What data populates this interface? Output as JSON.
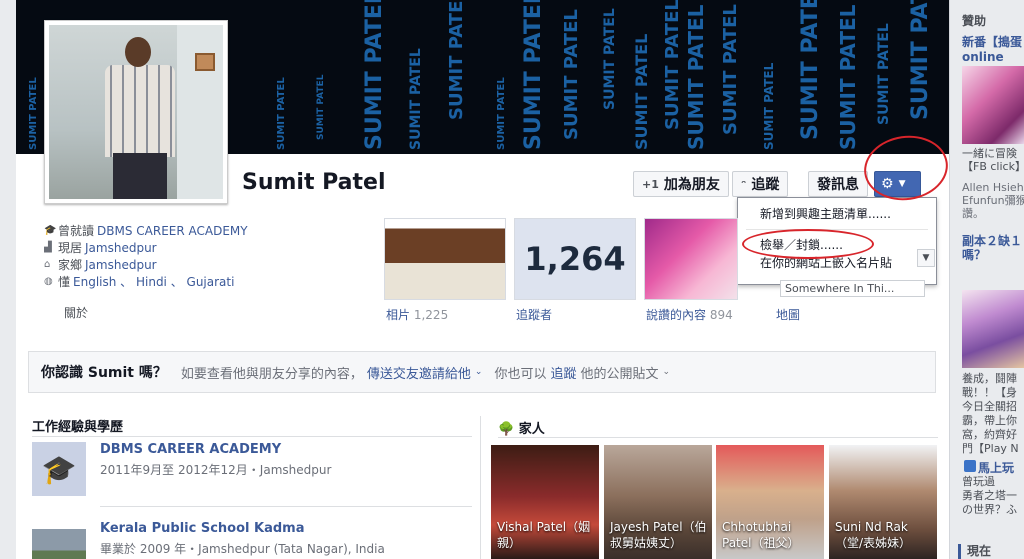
{
  "profile": {
    "name": "Sumit Patel",
    "cover_text": "SUMIT PATEL"
  },
  "actions": {
    "add_friend": "加為朋友",
    "follow": "追蹤",
    "message": "發訊息"
  },
  "dropdown": {
    "items": [
      "新增到興趣主題清單......",
      "檢舉／封鎖......",
      "在你的網站上嵌入名片貼"
    ]
  },
  "info": {
    "rows": [
      {
        "label": "曾就讀",
        "value": "DBMS CAREER ACADEMY"
      },
      {
        "label": "現居",
        "value": "Jamshedpur"
      },
      {
        "label": "家鄉",
        "value": "Jamshedpur"
      },
      {
        "label": "懂",
        "value": "English 、 Hindi 、 Gujarati"
      }
    ],
    "about": "關於"
  },
  "tiles": {
    "photos_label": "相片",
    "photos_count": "1,225",
    "followers_value": "1,264",
    "followers_label": "追蹤者",
    "likes_label": "說讚的內容",
    "likes_count": "894",
    "map_label": "地圖",
    "map_text": "Somewhere In Thi..."
  },
  "know": {
    "question": "你認識 Sumit 嗎？",
    "text1": "如要查看他與朋友分享的內容，",
    "link1": "傳送交友邀請給他",
    "text2": "你也可以",
    "link2": "追蹤",
    "text3": "他的公開貼文"
  },
  "work_edu": {
    "title": "工作經驗與學歷",
    "items": [
      {
        "school": "DBMS CAREER ACADEMY",
        "detail": "2011年9月至 2012年12月・Jamshedpur"
      },
      {
        "school": "Kerala Public School Kadma",
        "detail": "畢業於 2009 年・Jamshedpur (Tata Nagar), India"
      }
    ]
  },
  "family": {
    "title": "家人",
    "members": [
      {
        "caption": "Vishal Patel（姻親）"
      },
      {
        "caption": "Jayesh Patel（伯叔舅姑姨丈）"
      },
      {
        "caption": "Chhotubhai Patel（祖父）"
      },
      {
        "caption": "Suni Nd Rak（堂/表姊妹）"
      }
    ]
  },
  "sidebar": {
    "title": "贊助",
    "ad1_title": "新番【搗蛋",
    "ad1_sub": "online",
    "ad1_text": [
      "一緒に冒険",
      "【FB click】"
    ],
    "ad1_people": [
      "Allen Hsieh",
      "Efunfun彌猴",
      "讚。"
    ],
    "ad2_title": [
      "副本２缺１",
      "嗎？"
    ],
    "ad2_text": [
      "養成，鬪陣",
      "戰！！【身",
      "今日全關招",
      "霸，帶上你",
      "窩，約齊好",
      "門【Play N"
    ],
    "ad3_title": "馬上玩",
    "ad3_text": [
      "曾玩過",
      "勇者之塔一",
      "の世界？ふ"
    ],
    "footer": "現在"
  }
}
